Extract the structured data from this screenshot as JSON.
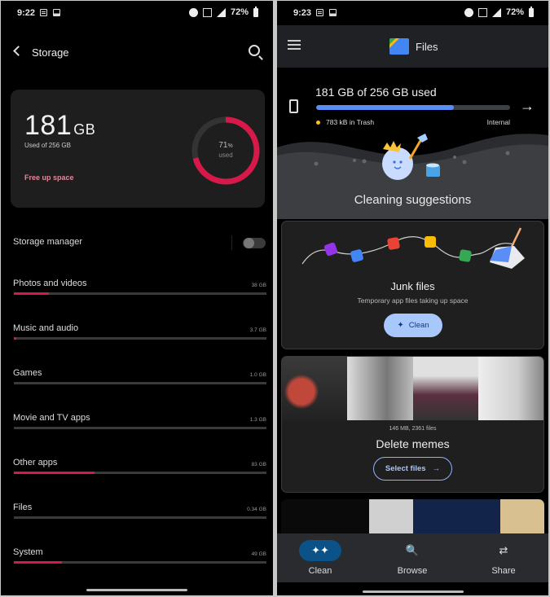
{
  "left": {
    "status": {
      "time": "9:22",
      "battery": "72%"
    },
    "header": {
      "title": "Storage"
    },
    "summary": {
      "used_value": "181",
      "used_unit": "GB",
      "used_of": "Used of 256 GB",
      "free_up": "Free up space",
      "ring_percent": "71",
      "ring_percent_sign": "%",
      "ring_label": "used",
      "used_fraction": 0.71
    },
    "storage_manager": {
      "label": "Storage manager",
      "enabled": false
    },
    "categories": [
      {
        "label": "Photos and videos",
        "size": "38 GB",
        "fraction": 0.14
      },
      {
        "label": "Music and audio",
        "size": "3.7 GB",
        "fraction": 0.01
      },
      {
        "label": "Games",
        "size": "1.0 GB",
        "fraction": 0.0
      },
      {
        "label": "Movie and TV apps",
        "size": "1.3 GB",
        "fraction": 0.0
      },
      {
        "label": "Other apps",
        "size": "83 GB",
        "fraction": 0.32
      },
      {
        "label": "Files",
        "size": "0.34 GB",
        "fraction": 0.0
      },
      {
        "label": "System",
        "size": "49 GB",
        "fraction": 0.19
      }
    ],
    "colors": {
      "accent": "#d7194a",
      "track": "#3a3a3a",
      "free_up": "#e2879c"
    }
  },
  "right": {
    "status": {
      "time": "9:23",
      "battery": "72%"
    },
    "header": {
      "title": "Files"
    },
    "usage": {
      "title": "181 GB of 256 GB used",
      "fraction": 0.71,
      "trash": "783 kB in Trash",
      "location": "Internal"
    },
    "suggestions_title": "Cleaning suggestions",
    "junk": {
      "title": "Junk files",
      "description": "Temporary app files taking up space",
      "button": "Clean"
    },
    "memes": {
      "meta": "146 MB, 2361 files",
      "title": "Delete memes",
      "button": "Select files"
    },
    "nav": [
      {
        "label": "Clean",
        "icon": "sparkle-icon",
        "active": true
      },
      {
        "label": "Browse",
        "icon": "folder-search-icon",
        "active": false
      },
      {
        "label": "Share",
        "icon": "swap-arrows-icon",
        "active": false
      }
    ],
    "colors": {
      "progress": "#5a8df5",
      "trash_dot": "#fbc02d",
      "clean_button": "#a8c7fa",
      "nav_active": "#0b5289"
    }
  }
}
